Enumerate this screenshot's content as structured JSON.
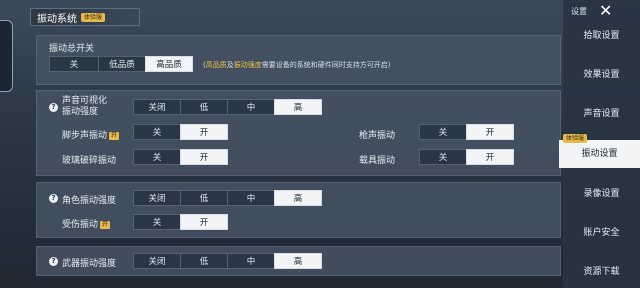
{
  "header": {
    "title": "振动系统",
    "badge": "体验服"
  },
  "master": {
    "label": "振动总开关",
    "options": [
      "关",
      "低品质",
      "高品质"
    ],
    "selected": 2,
    "note_open": "(",
    "note_hl1": "高品质",
    "note_mid": "及",
    "note_hl2": "振动强度",
    "note_tail": "需要设备的系统和硬件同时支持方可开启)"
  },
  "sound": {
    "label_line1": "声音可视化",
    "label_line2": "振动强度",
    "options": [
      "关闭",
      "低",
      "中",
      "高"
    ],
    "selected": 3
  },
  "toggles": {
    "off": "关",
    "on": "开",
    "footstep": {
      "label": "脚步声振动",
      "tag": "开"
    },
    "glass": {
      "label": "玻璃破碎振动"
    },
    "gun": {
      "label": "枪声振动"
    },
    "vehicle": {
      "label": "载具振动"
    },
    "hurt": {
      "label": "受伤振动",
      "tag": "开"
    }
  },
  "character": {
    "label": "角色振动强度",
    "options": [
      "关闭",
      "低",
      "中",
      "高"
    ],
    "selected": 3
  },
  "weapon": {
    "label": "武器振动强度",
    "options": [
      "关闭",
      "低",
      "中",
      "高"
    ],
    "selected": 3
  },
  "help_glyph": "?",
  "sidebar": {
    "top_label": "设置",
    "close": "✕",
    "items": [
      "拾取设置",
      "效果设置",
      "声音设置",
      "振动设置",
      "录像设置",
      "账户安全",
      "资源下载"
    ],
    "active": 3,
    "active_tag": "体验服"
  }
}
